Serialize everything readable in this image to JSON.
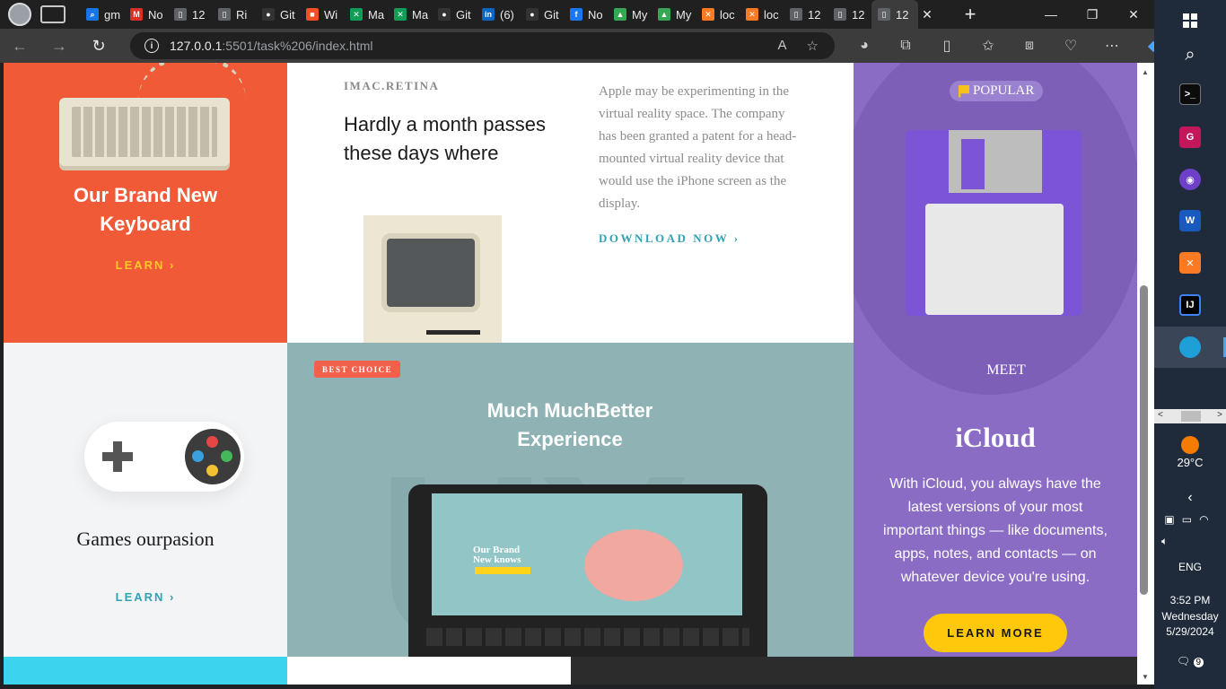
{
  "browser": {
    "tabs": [
      {
        "title": "gm",
        "icon": "search-icon",
        "color": "#1a73e8"
      },
      {
        "title": "No",
        "icon": "gmail-icon",
        "color": "#d93025"
      },
      {
        "title": "12",
        "icon": "page-icon",
        "color": "#5f6368"
      },
      {
        "title": "Ri",
        "icon": "page-icon",
        "color": "#5f6368"
      },
      {
        "title": "Git",
        "icon": "github-icon",
        "color": "#333333"
      },
      {
        "title": "Wi",
        "icon": "microsoft-icon",
        "color": "#f25022"
      },
      {
        "title": "Ma",
        "icon": "x-logo-icon",
        "color": "#0f9d58"
      },
      {
        "title": "Ma",
        "icon": "x-logo-icon",
        "color": "#0f9d58"
      },
      {
        "title": "Git",
        "icon": "github-icon",
        "color": "#333333"
      },
      {
        "title": "(6)",
        "icon": "linkedin-icon",
        "color": "#0a66c2"
      },
      {
        "title": "Git",
        "icon": "github-icon",
        "color": "#333333"
      },
      {
        "title": "No",
        "icon": "facebook-icon",
        "color": "#1877f2"
      },
      {
        "title": "My",
        "icon": "drive-icon",
        "color": "#34a853"
      },
      {
        "title": "My",
        "icon": "drive-icon",
        "color": "#34a853"
      },
      {
        "title": "loc",
        "icon": "xampp-icon",
        "color": "#fb7a24"
      },
      {
        "title": "loc",
        "icon": "xampp-icon",
        "color": "#fb7a24"
      },
      {
        "title": "12",
        "icon": "page-icon",
        "color": "#5f6368"
      },
      {
        "title": "12",
        "icon": "page-icon",
        "color": "#5f6368"
      },
      {
        "title": "12",
        "icon": "page-icon",
        "color": "#5f6368"
      }
    ],
    "url_host": "127.0.0.1",
    "url_path": ":5501/task%206/index.html"
  },
  "page": {
    "keyboard": {
      "title_line1": "Our Brand New",
      "title_line2": "Keyboard",
      "link": "LEARN ›"
    },
    "imac": {
      "eyebrow": "IMAC.RETINA",
      "headline": "Hardly a month passes these days where",
      "description": "Apple may be experimenting in the virtual reality space. The company has been granted a patent for a head-mounted virtual reality device that would use the iPhone screen as the display.",
      "download": "DOWNLOAD NOW ›"
    },
    "icloud": {
      "badge": "POPULAR",
      "meet": "MEET",
      "title": "iCloud",
      "description": "With iCloud, you always have the latest versions of your most important things — like documents, apps, notes, and contacts — on whatever device you're using.",
      "button": "LEARN MORE"
    },
    "games": {
      "title": "Games ourpasion",
      "link": "LEARN ›"
    },
    "tablet": {
      "badge": "BEST CHOICE",
      "title_line1": "Much MuchBetter",
      "title_line2": "Experience",
      "screen_text1": "Our Brand",
      "screen_text2": "New knows"
    }
  },
  "taskbar": {
    "weather": "29°C",
    "language": "ENG",
    "time": "3:52 PM",
    "day": "Wednesday",
    "date": "5/29/2024",
    "notifications": "9"
  }
}
